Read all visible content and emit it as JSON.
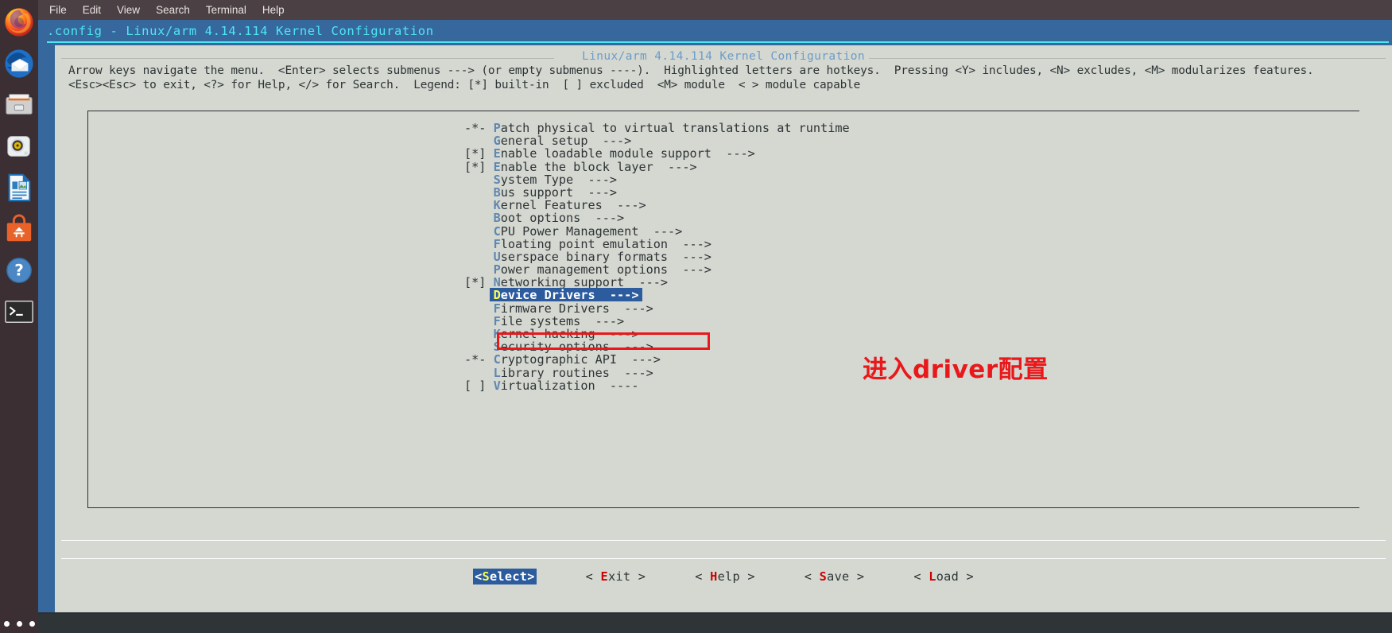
{
  "dock": {
    "items": [
      {
        "name": "firefox",
        "label": "Firefox Web Browser"
      },
      {
        "name": "thunderbird",
        "label": "Thunderbird Mail"
      },
      {
        "name": "files",
        "label": "Files"
      },
      {
        "name": "rhythmbox",
        "label": "Rhythmbox"
      },
      {
        "name": "libreoffice-impress",
        "label": "LibreOffice Impress"
      },
      {
        "name": "ubuntu-software",
        "label": "Ubuntu Software"
      },
      {
        "name": "help",
        "label": "Help"
      },
      {
        "name": "terminal",
        "label": "Terminal"
      }
    ],
    "show_apps_label": "Show Applications"
  },
  "menubar": {
    "items": [
      "File",
      "Edit",
      "View",
      "Search",
      "Terminal",
      "Help"
    ]
  },
  "window": {
    "title": ".config - Linux/arm 4.14.114 Kernel Configuration"
  },
  "dialog": {
    "header": "Linux/arm 4.14.114 Kernel Configuration",
    "help_line_1": "Arrow keys navigate the menu.  <Enter> selects submenus ---> (or empty submenus ----).  Highlighted letters are hotkeys.  Pressing <Y> includes, <N> excludes, <M> modularizes features.",
    "help_line_2": "<Esc><Esc> to exit, <?> for Help, </> for Search.  Legend: [*] built-in  [ ] excluded  <M> module  < > module capable"
  },
  "menu": {
    "items": [
      {
        "flag": "-*-",
        "hot": "P",
        "text": "atch physical to virtual translations at runtime",
        "arrow": "",
        "selected": false
      },
      {
        "flag": "",
        "hot": "G",
        "text": "eneral setup",
        "arrow": "--->",
        "selected": false
      },
      {
        "flag": "[*]",
        "hot": "E",
        "text": "nable loadable module support",
        "arrow": "--->",
        "selected": false
      },
      {
        "flag": "[*]",
        "hot": "E",
        "text": "nable the block layer",
        "arrow": "--->",
        "selected": false
      },
      {
        "flag": "",
        "hot": "S",
        "text": "ystem Type",
        "arrow": "--->",
        "selected": false
      },
      {
        "flag": "",
        "hot": "B",
        "text": "us support",
        "arrow": "--->",
        "selected": false
      },
      {
        "flag": "",
        "hot": "K",
        "text": "ernel Features",
        "arrow": "--->",
        "selected": false
      },
      {
        "flag": "",
        "hot": "B",
        "text": "oot options",
        "arrow": "--->",
        "selected": false
      },
      {
        "flag": "",
        "hot": "C",
        "text": "PU Power Management",
        "arrow": "--->",
        "selected": false
      },
      {
        "flag": "",
        "hot": "F",
        "text": "loating point emulation",
        "arrow": "--->",
        "selected": false
      },
      {
        "flag": "",
        "hot": "U",
        "text": "serspace binary formats",
        "arrow": "--->",
        "selected": false
      },
      {
        "flag": "",
        "hot": "P",
        "text": "ower management options",
        "arrow": "--->",
        "selected": false
      },
      {
        "flag": "[*]",
        "hot": "N",
        "text": "etworking support",
        "arrow": "--->",
        "selected": false
      },
      {
        "flag": "",
        "hot": "D",
        "text": "evice Drivers",
        "arrow": "--->",
        "selected": true
      },
      {
        "flag": "",
        "hot": "F",
        "text": "irmware Drivers",
        "arrow": "--->",
        "selected": false
      },
      {
        "flag": "",
        "hot": "F",
        "text": "ile systems",
        "arrow": "--->",
        "selected": false
      },
      {
        "flag": "",
        "hot": "K",
        "text": "ernel hacking",
        "arrow": "--->",
        "selected": false
      },
      {
        "flag": "",
        "hot": "S",
        "text": "ecurity options",
        "arrow": "--->",
        "selected": false
      },
      {
        "flag": "-*-",
        "hot": "C",
        "text": "ryptographic API",
        "arrow": "--->",
        "selected": false
      },
      {
        "flag": "",
        "hot": "L",
        "text": "ibrary routines",
        "arrow": "--->",
        "selected": false
      },
      {
        "flag": "[ ]",
        "hot": "V",
        "text": "irtualization",
        "arrow": "----",
        "selected": false
      }
    ]
  },
  "buttons": [
    {
      "name": "select",
      "pre": "<",
      "hot": "S",
      "post": "elect>",
      "active": true
    },
    {
      "name": "exit",
      "pre": "< ",
      "hot": "E",
      "post": "xit >",
      "active": false
    },
    {
      "name": "help",
      "pre": "< ",
      "hot": "H",
      "post": "elp >",
      "active": false
    },
    {
      "name": "save",
      "pre": "< ",
      "hot": "S",
      "post": "ave >",
      "active": false
    },
    {
      "name": "load",
      "pre": "< ",
      "hot": "L",
      "post": "oad >",
      "active": false
    }
  ],
  "annotation": {
    "text": "进入driver配置",
    "color": "#e8181b"
  },
  "colors": {
    "dialog_bg": "#d4d8d1",
    "backdrop_blue": "#36689e",
    "title_cyan": "#4fe6ef",
    "hotkey_blue": "#5f87af",
    "selection_blue": "#2c5c9e",
    "selected_hotkey_yellow": "#ffff4d",
    "button_hotkey_red": "#cc0000",
    "annotation_red": "#e8181b"
  }
}
